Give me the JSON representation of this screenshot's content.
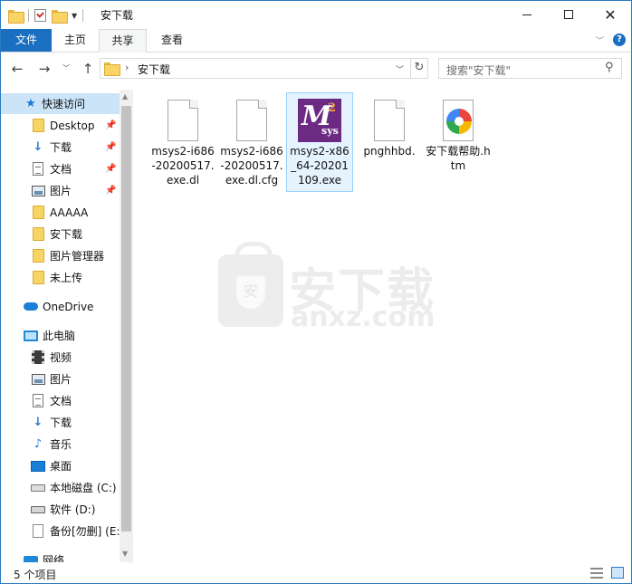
{
  "window": {
    "title": "安下载"
  },
  "ribbon": {
    "tabs": [
      {
        "label": "文件"
      },
      {
        "label": "主页"
      },
      {
        "label": "共享"
      },
      {
        "label": "查看"
      }
    ]
  },
  "nav": {
    "address": "安下载",
    "search_placeholder": "搜索\"安下载\""
  },
  "sidebar": {
    "items": [
      {
        "label": "快速访问",
        "icon": "star-icon"
      },
      {
        "label": "Desktop",
        "icon": "folder-icon",
        "pinned": true
      },
      {
        "label": "下载",
        "icon": "download-arrow-icon",
        "pinned": true
      },
      {
        "label": "文档",
        "icon": "document-icon",
        "pinned": true
      },
      {
        "label": "图片",
        "icon": "picture-icon",
        "pinned": true
      },
      {
        "label": "AAAAA",
        "icon": "folder-icon"
      },
      {
        "label": "安下载",
        "icon": "folder-icon"
      },
      {
        "label": "图片管理器",
        "icon": "folder-icon"
      },
      {
        "label": "未上传",
        "icon": "folder-icon"
      },
      {
        "label": "OneDrive",
        "icon": "cloud-icon"
      },
      {
        "label": "此电脑",
        "icon": "computer-icon"
      },
      {
        "label": "视频",
        "icon": "video-icon"
      },
      {
        "label": "图片",
        "icon": "picture-icon"
      },
      {
        "label": "文档",
        "icon": "document-icon"
      },
      {
        "label": "下载",
        "icon": "download-arrow-icon"
      },
      {
        "label": "音乐",
        "icon": "music-note-icon"
      },
      {
        "label": "桌面",
        "icon": "desktop-icon"
      },
      {
        "label": "本地磁盘 (C:)",
        "icon": "drive-icon"
      },
      {
        "label": "软件 (D:)",
        "icon": "drive-icon"
      },
      {
        "label": "备份[勿删] (E:",
        "icon": "file-icon"
      },
      {
        "label": "网络",
        "icon": "network-icon"
      }
    ]
  },
  "files": [
    {
      "name": "msys2-i686-20200517.exe.dl",
      "icon": "blank-file-icon"
    },
    {
      "name": "msys2-i686-20200517.exe.dl.cfg",
      "icon": "blank-file-icon"
    },
    {
      "name": "msys2-x86_64-20201109.exe",
      "icon": "msys2-app-icon",
      "selected": true
    },
    {
      "name": "pnghhbd.",
      "icon": "blank-file-icon"
    },
    {
      "name": "安下载帮助.htm",
      "icon": "html-file-icon"
    }
  ],
  "msys_icon": {
    "letter": "M",
    "superscript": "2",
    "sub": "sys"
  },
  "watermark": {
    "cn": "安下载",
    "en": "anxz.com",
    "shield_char": "安"
  },
  "status": {
    "item_count": "5 个项目"
  },
  "colors": {
    "accent": "#1a6fc0",
    "selection": "#cce4f7",
    "msys_purple": "#6b2b83"
  }
}
